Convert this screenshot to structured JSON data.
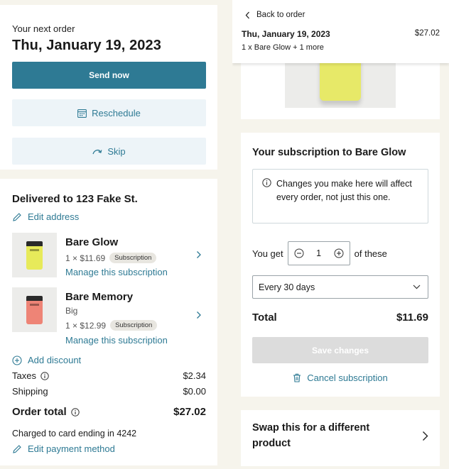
{
  "colors": {
    "accent": "#2e7a94",
    "page_bg": "#f6f4ec",
    "secondary_btn_bg": "#edf4f8",
    "disabled_btn_bg": "#dcdcdc"
  },
  "order": {
    "next_label": "Your next order",
    "date": "Thu, January 19, 2023",
    "send_now": "Send now",
    "reschedule": "Reschedule",
    "skip": "Skip"
  },
  "delivery": {
    "title": "Delivered to 123 Fake St.",
    "edit_address": "Edit address",
    "products": [
      {
        "name": "Bare Glow",
        "variant": "",
        "price": "1 × $11.69",
        "badge": "Subscription",
        "manage": "Manage this subscription",
        "icon": "product-can-yellow"
      },
      {
        "name": "Bare Memory",
        "variant": "Big",
        "price": "1 × $12.99",
        "badge": "Subscription",
        "manage": "Manage this subscription",
        "icon": "product-can-red"
      }
    ],
    "add_discount": "Add discount",
    "taxes_label": "Taxes",
    "taxes_value": "$2.34",
    "shipping_label": "Shipping",
    "shipping_value": "$0.00",
    "total_label": "Order total",
    "total_value": "$27.02",
    "charged": "Charged to card ending in 4242",
    "edit_payment": "Edit payment method"
  },
  "detail": {
    "back": "Back to order",
    "date": "Thu, January 19, 2023",
    "price": "$27.02",
    "summary": "1 x Bare Glow + 1 more",
    "sub_title": "Your subscription to Bare Glow",
    "notice": "Changes you make here will affect every order, not just this one.",
    "you_get": "You get",
    "quantity": "1",
    "of_these": "of these",
    "frequency": "Every 30 days",
    "total_label": "Total",
    "total_value": "$11.69",
    "save": "Save changes",
    "cancel": "Cancel subscription",
    "swap": "Swap this for a different product"
  }
}
